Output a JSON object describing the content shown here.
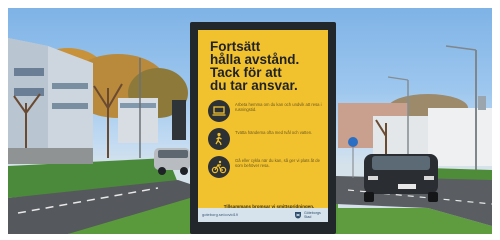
{
  "poster": {
    "headline": "Fortsätt\nhålla avstånd.\nTack för att\ndu tar ansvar.",
    "rows": [
      {
        "icon": "laptop-icon",
        "text": "Arbeta hemma om du kan och undvik att resa i rusningstid."
      },
      {
        "icon": "walking-icon",
        "text": "Tvätta händerna ofta med tvål och vatten."
      },
      {
        "icon": "bicycle-icon",
        "text": "Gå eller cykla när du kan, så ger vi plats åt de som behöver resa."
      }
    ],
    "tagline": "Tillsammans bromsar vi smittspridningen.",
    "footer_url": "goteborg.se/covid19",
    "logo_text": "Göteborgs\nStad"
  },
  "colors": {
    "poster_yellow": "#f2c12e",
    "frame": "#22272b",
    "icon_circle": "#2d3134"
  }
}
